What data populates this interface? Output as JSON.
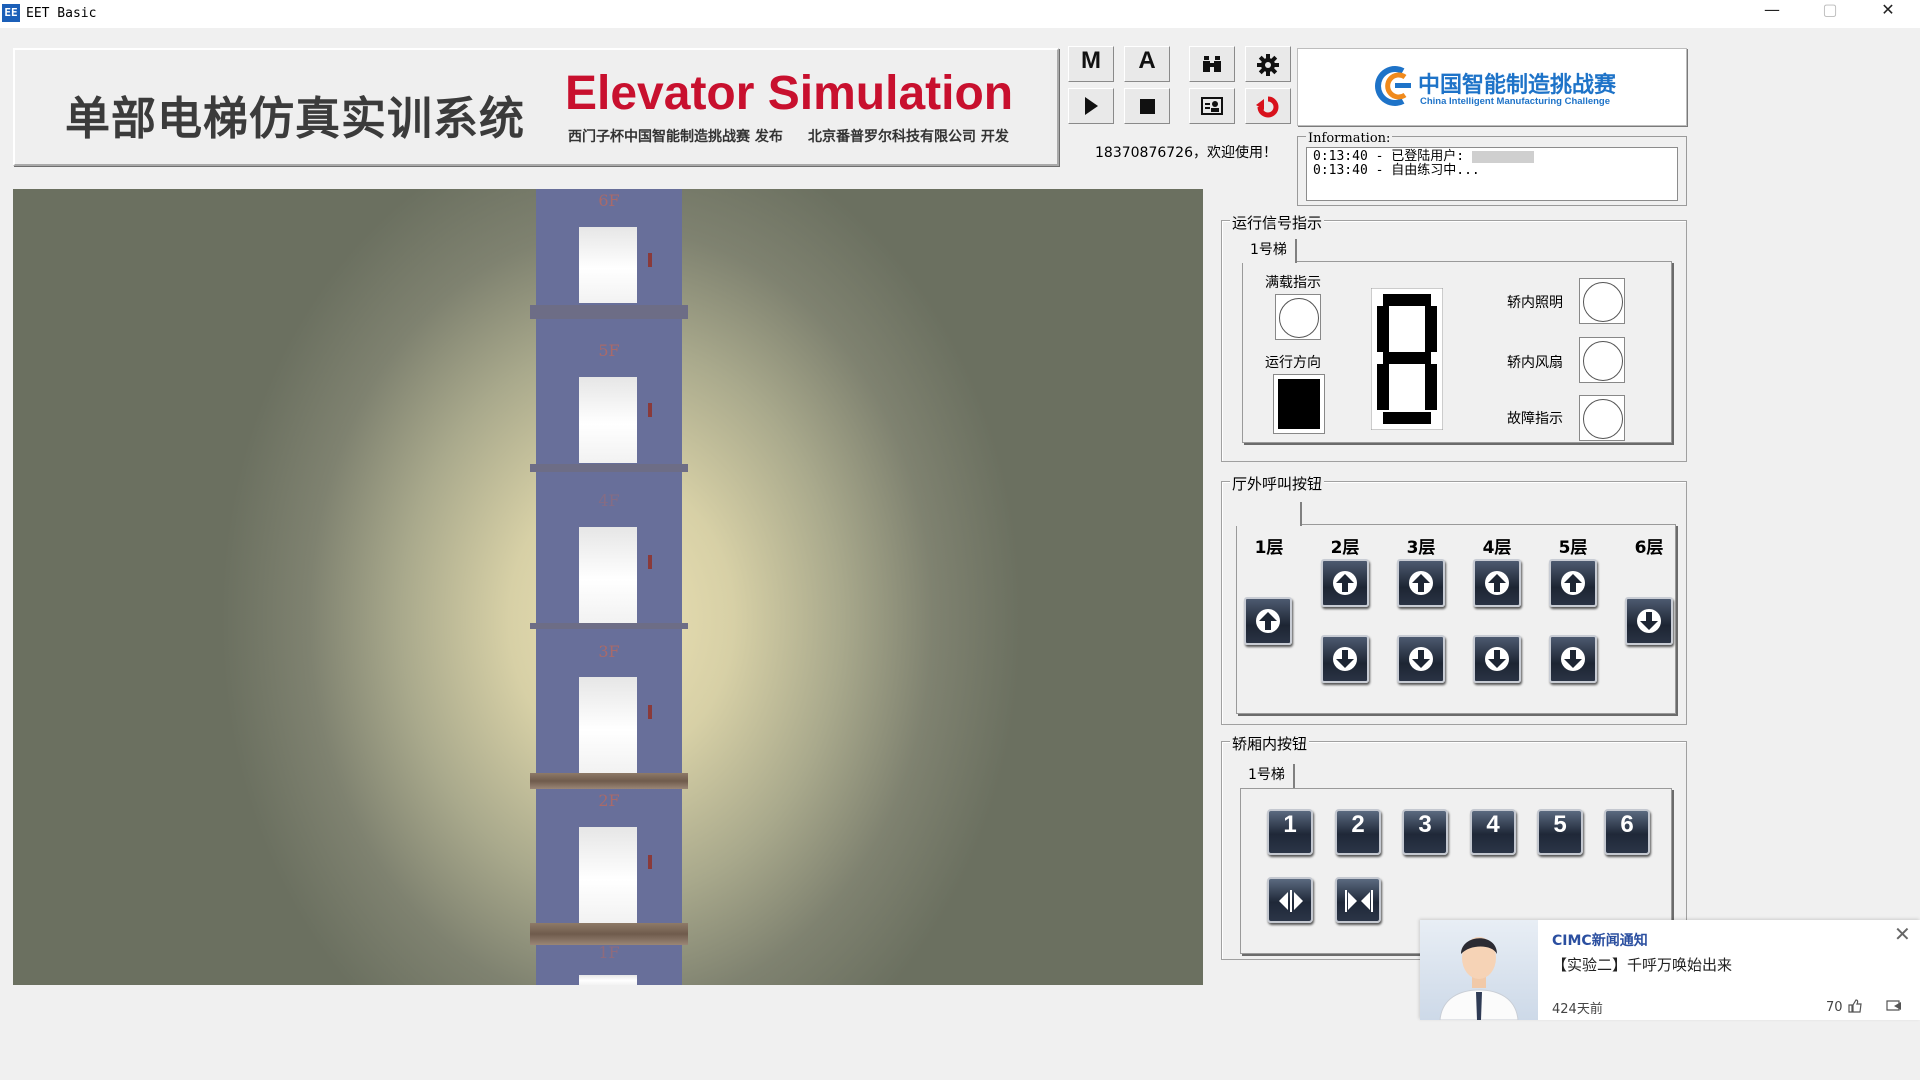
{
  "window": {
    "title": "EET Basic",
    "icon_text": "EE",
    "controls": {
      "minimize": "—",
      "maximize": "▢",
      "close": "✕"
    }
  },
  "banner": {
    "title_cn": "单部电梯仿真实训系统",
    "title_en": "Elevator Simulation",
    "publisher": "西门子杯中国智能制造挑战赛 发布",
    "developer": "北京番普罗尔科技有限公司 开发"
  },
  "toolbar": {
    "manual_label": "M",
    "auto_label": "A",
    "icons": [
      "play-icon",
      "stop-icon",
      "binoculars-icon",
      "gear-icon",
      "user-card-icon",
      "reset-icon"
    ]
  },
  "logo": {
    "text_cn": "中国智能制造挑战赛",
    "text_en": "China Intelligent Manufacturing Challenge"
  },
  "user_line": "18370876726，欢迎使用！",
  "information": {
    "legend": "Information:",
    "lines": [
      "0:13:40 - 已登陆用户:",
      "0:13:40 - 自由练习中..."
    ]
  },
  "scene": {
    "floors": [
      "6F",
      "5F",
      "4F",
      "3F",
      "2F",
      "1F"
    ],
    "colors": {
      "shaft": "#686f9a",
      "label": "#a86a6a"
    }
  },
  "signal_panel": {
    "legend": "运行信号指示",
    "tab": "1号梯",
    "full_load": "满载指示",
    "direction": "运行方向",
    "car_light": "轿内照明",
    "car_fan": "轿内风扇",
    "fault": "故障指示",
    "direction_state": "stopped",
    "display_digit": "8"
  },
  "hall_panel": {
    "legend": "厅外呼叫按钮",
    "floors": [
      "1层",
      "2层",
      "3层",
      "4层",
      "5层",
      "6层"
    ]
  },
  "car_panel": {
    "legend": "轿厢内按钮",
    "tab": "1号梯",
    "floor_buttons": [
      "1",
      "2",
      "3",
      "4",
      "5",
      "6"
    ],
    "door_buttons": [
      "door-open-icon",
      "door-close-icon"
    ]
  },
  "toast": {
    "title": "CIMC新闻通知",
    "message": "【实验二】千呼万唤始出来",
    "time": "424天前",
    "likes": "70",
    "close": "✕"
  }
}
